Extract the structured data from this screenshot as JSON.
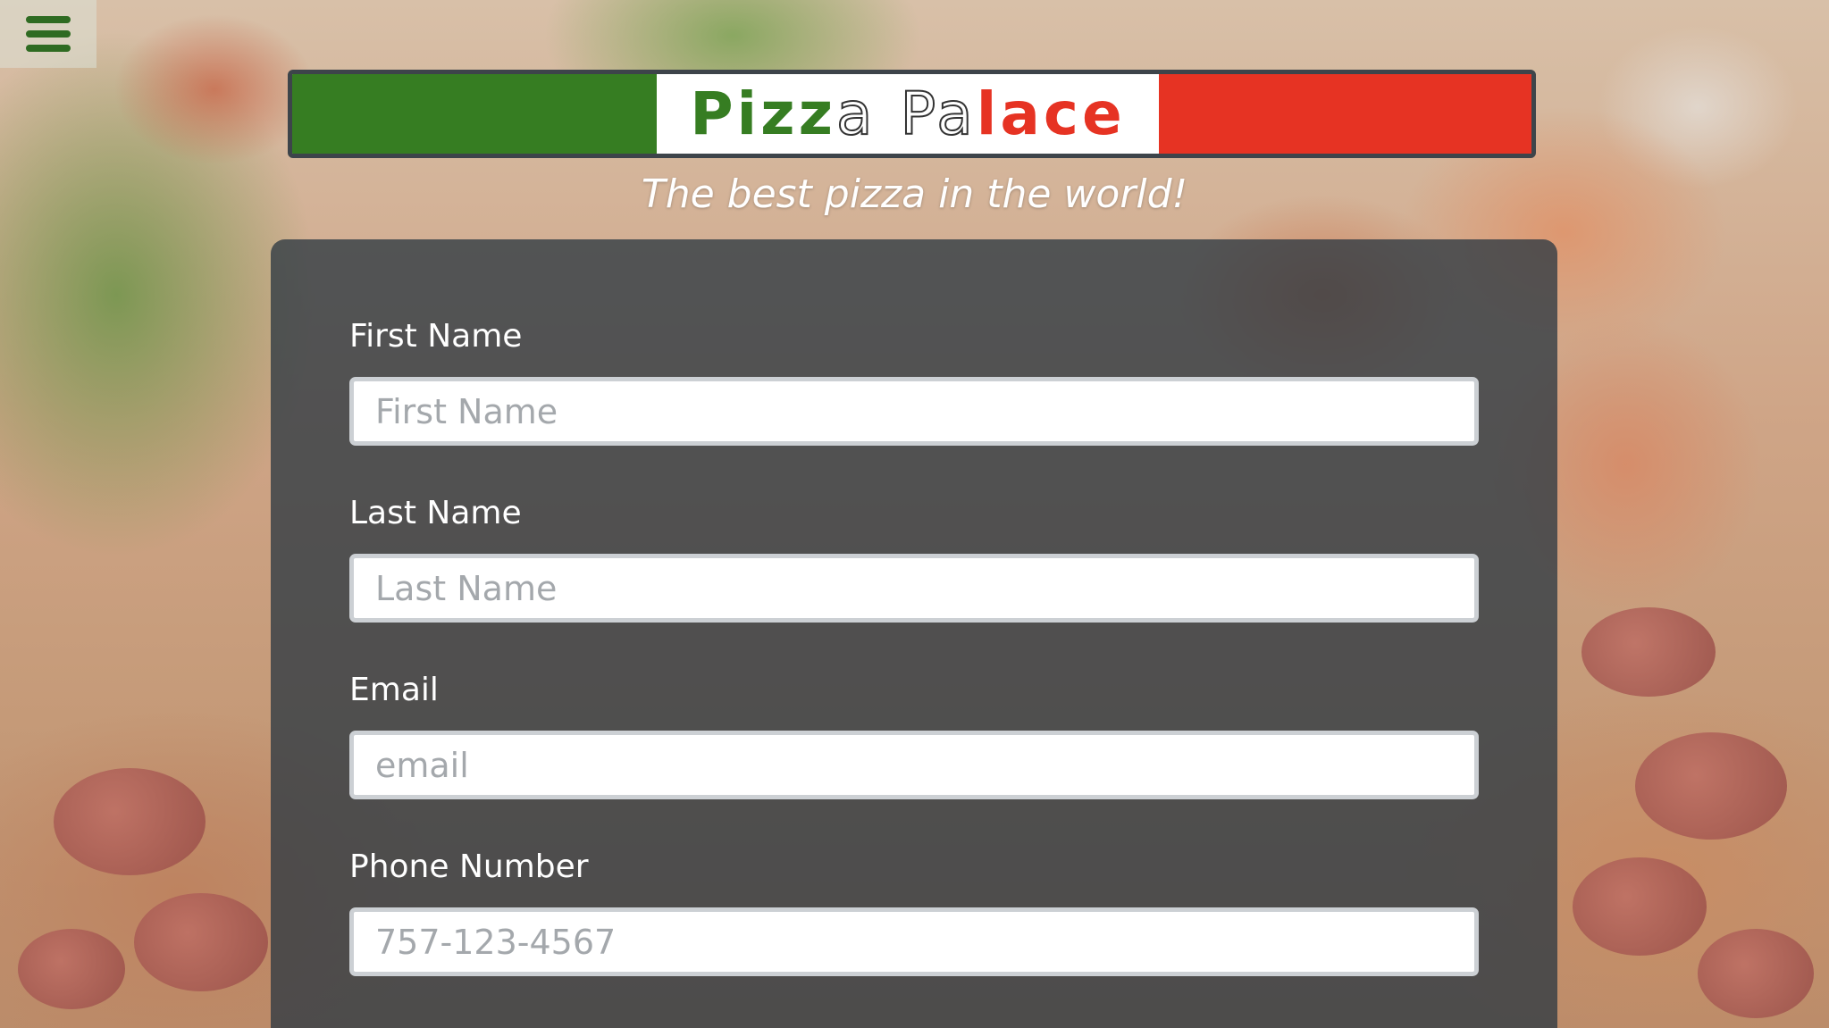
{
  "menu": {
    "icon": "hamburger-menu-icon",
    "color": "#2f6b22"
  },
  "header": {
    "logo": {
      "part1": "Pizz",
      "part2": "a",
      "space": " ",
      "part3": "P",
      "part4": "a",
      "part5": "lace"
    },
    "tagline": "The best pizza in the world!",
    "colors": {
      "green": "#367d22",
      "white": "#ffffff",
      "red": "#e63323",
      "border": "#3d444a"
    }
  },
  "form": {
    "panel_color": "rgba(46,58,66,0.78)",
    "fields": [
      {
        "label": "First Name",
        "placeholder": "First Name",
        "value": ""
      },
      {
        "label": "Last Name",
        "placeholder": "Last Name",
        "value": ""
      },
      {
        "label": "Email",
        "placeholder": "email",
        "value": ""
      },
      {
        "label": "Phone Number",
        "placeholder": "757-123-4567",
        "value": ""
      }
    ]
  }
}
